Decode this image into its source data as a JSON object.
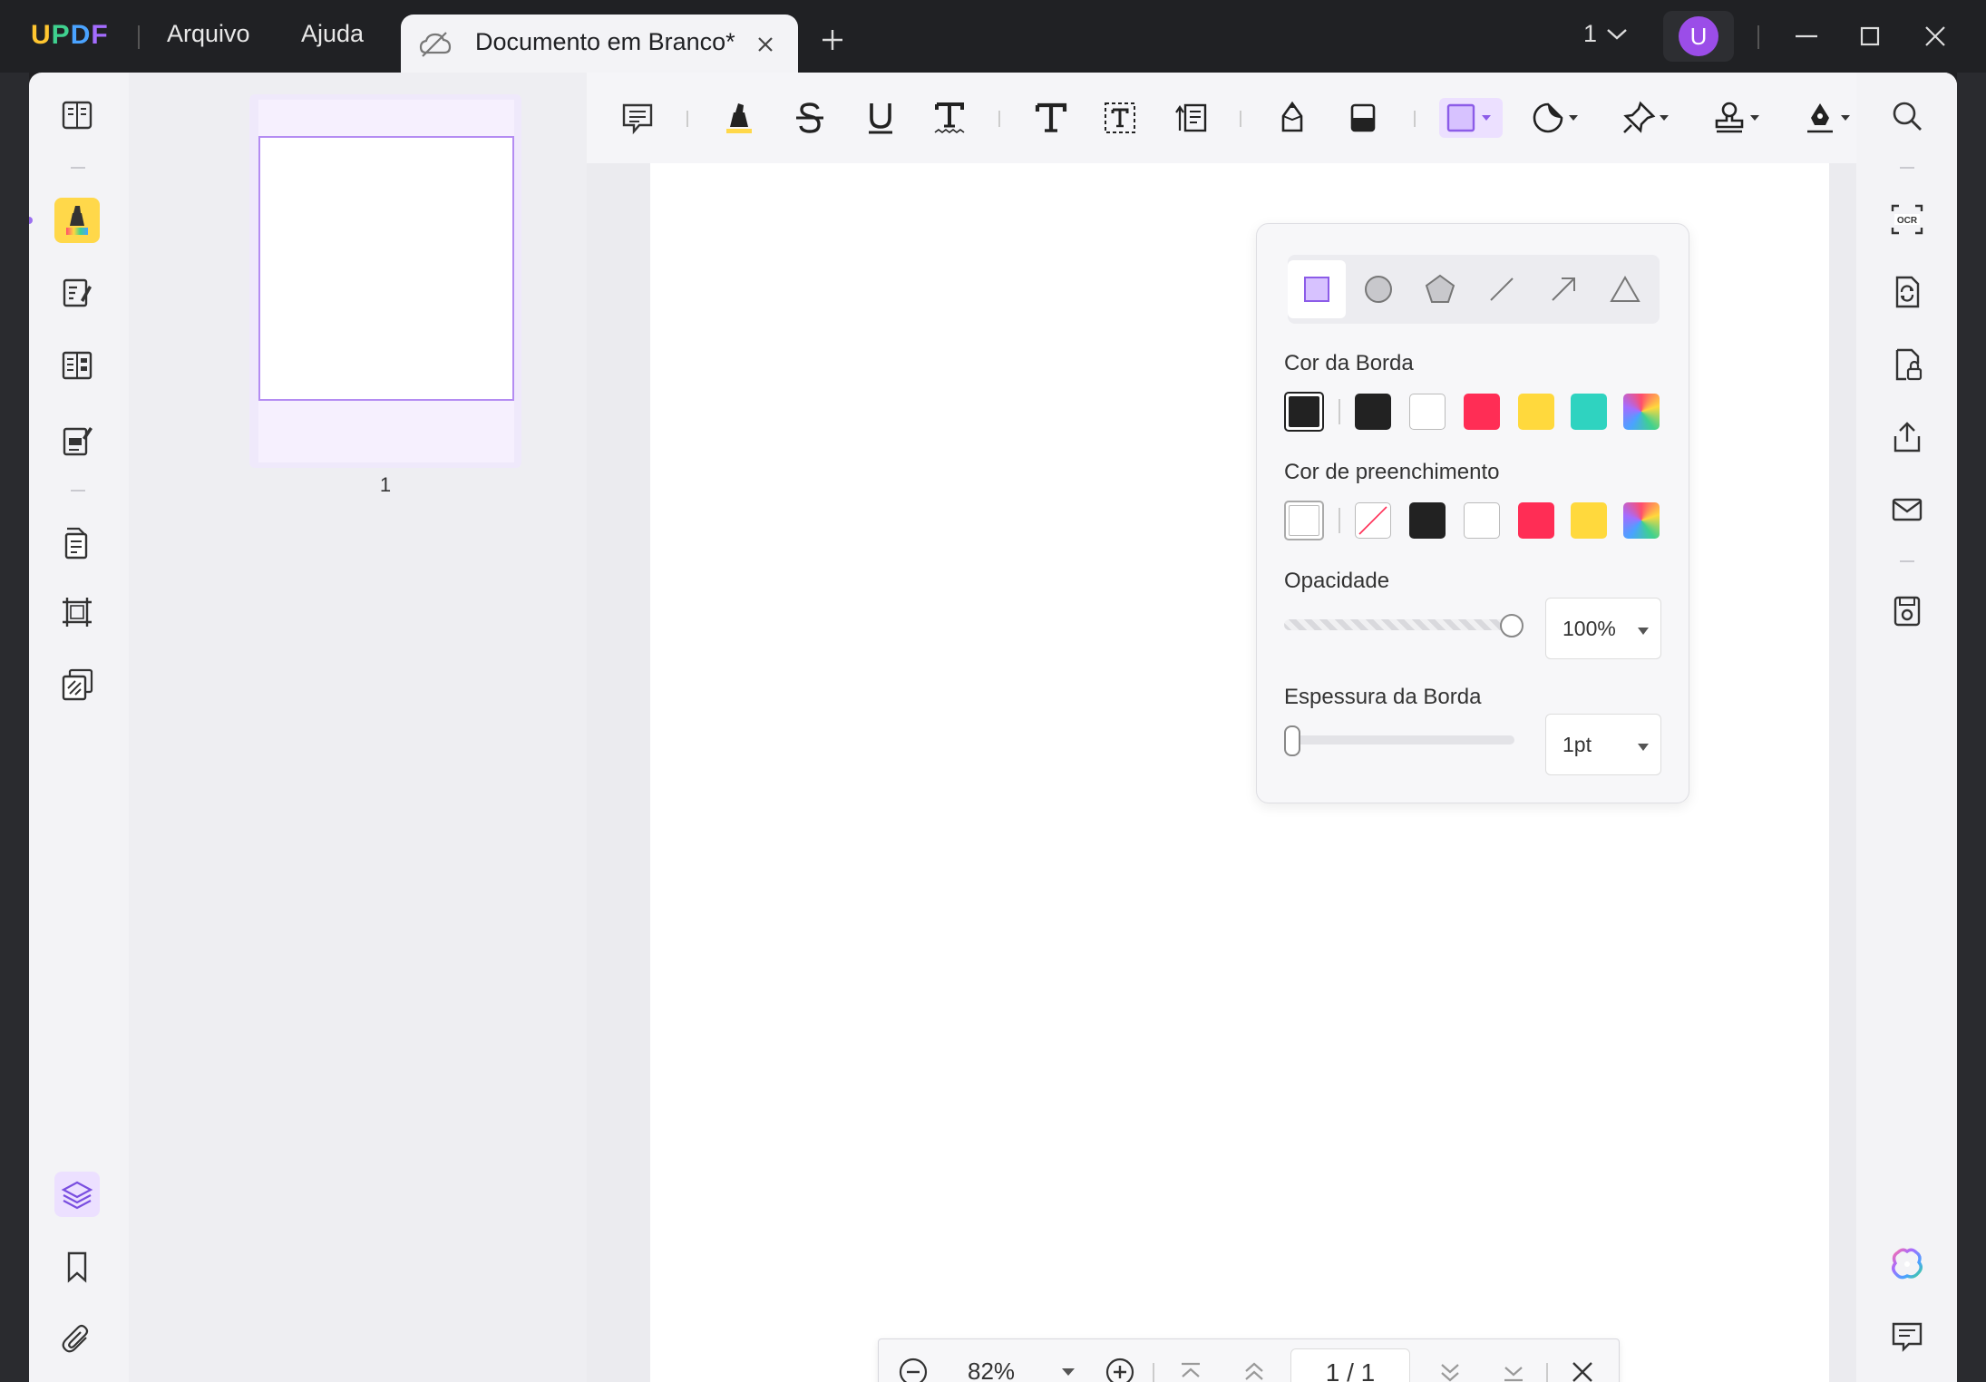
{
  "app": {
    "logo": "UPDF",
    "logo_colors": [
      "#ffc630",
      "#3fd18f",
      "#4aa3ff",
      "#a46cff"
    ],
    "menu": [
      "Arquivo",
      "Ajuda"
    ],
    "tab_title": "Documento em Branco*",
    "page_count": "1",
    "avatar_letter": "U"
  },
  "toolbar": {
    "tools": [
      "comment-icon",
      "highlight-icon",
      "strikethrough-icon",
      "underline-icon",
      "squiggly-icon",
      "text-icon",
      "textbox-icon",
      "text-callout-icon",
      "pencil-icon",
      "eraser-icon",
      "rectangle-shape-icon",
      "sticker-icon",
      "pin-icon",
      "stamp-icon",
      "signature-icon"
    ],
    "active_tool": "rectangle-shape-icon"
  },
  "thumbnail": {
    "label": "1"
  },
  "shape_popover": {
    "shapes": [
      "rectangle",
      "ellipse",
      "polygon",
      "line",
      "arrow",
      "triangle"
    ],
    "selected_shape": "rectangle",
    "border_color_label": "Cor da Borda",
    "border_colors": [
      "#222222",
      "#222222",
      "#ffffff",
      "#ff2d55",
      "#ffd93d",
      "#2fd3c0",
      "gradient"
    ],
    "fill_color_label": "Cor de preenchimento",
    "fill_colors": [
      "#ffffff",
      "none",
      "#222222",
      "#ffffff",
      "#ff2d55",
      "#ffd93d",
      "gradient"
    ],
    "opacity_label": "Opacidade",
    "opacity_value": "100%",
    "opacity_level": 1.0,
    "border_width_label": "Espessura da Borda",
    "border_width_value": "1pt",
    "border_width_level": 0.0
  },
  "navbar": {
    "zoom": "82%",
    "page_indicator": "1 / 1"
  },
  "colors": {
    "accent": "#9b6ff0",
    "active_tool_bg": "#ece0ff",
    "highlight_active": "#ffd84a"
  }
}
